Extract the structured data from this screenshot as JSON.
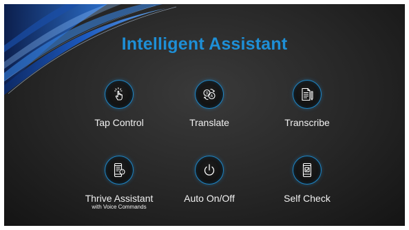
{
  "title": "Intelligent Assistant",
  "colors": {
    "title": "#1e8fd6",
    "icon_ring": "#1e86c7",
    "background": "#2a2a2a",
    "text": "#f2f2f2"
  },
  "tiles": [
    {
      "label": "Tap Control",
      "sublabel": "",
      "icon": "tap-hand-icon"
    },
    {
      "label": "Translate",
      "sublabel": "",
      "icon": "translate-icon"
    },
    {
      "label": "Transcribe",
      "sublabel": "",
      "icon": "transcribe-icon"
    },
    {
      "label": "Thrive Assistant",
      "sublabel": "with Voice Commands",
      "icon": "phone-assistant-icon"
    },
    {
      "label": "Auto On/Off",
      "sublabel": "",
      "icon": "power-icon"
    },
    {
      "label": "Self Check",
      "sublabel": "",
      "icon": "phone-check-icon"
    }
  ]
}
